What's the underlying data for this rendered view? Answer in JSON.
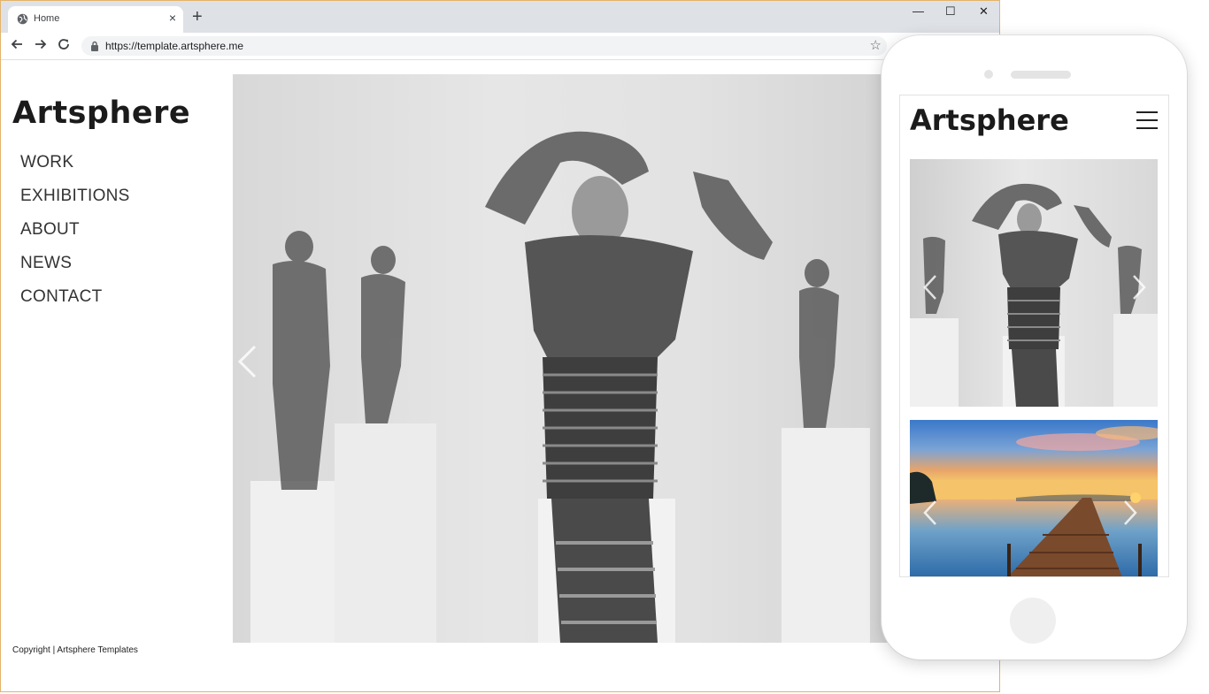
{
  "browser": {
    "tab_title": "Home",
    "tab_close": "×",
    "new_tab": "+",
    "url": "https://template.artsphere.me",
    "bookmark": "☆",
    "controls": {
      "minimize": "—",
      "maximize": "☐",
      "close": "✕"
    }
  },
  "site": {
    "logo": "Artsphere",
    "nav": [
      "WORK",
      "EXHIBITIONS",
      "ABOUT",
      "NEWS",
      "CONTACT"
    ],
    "copyright": "Copyright | Artsphere Templates"
  },
  "mobile": {
    "logo": "Artsphere"
  },
  "colors": {
    "accent_border": "#e3b46a",
    "text": "#1b1b1b"
  },
  "icons": [
    "globe-icon",
    "back-icon",
    "forward-icon",
    "reload-icon",
    "lock-icon",
    "star-icon",
    "hamburger-icon",
    "chevron-left-icon",
    "chevron-right-icon"
  ]
}
